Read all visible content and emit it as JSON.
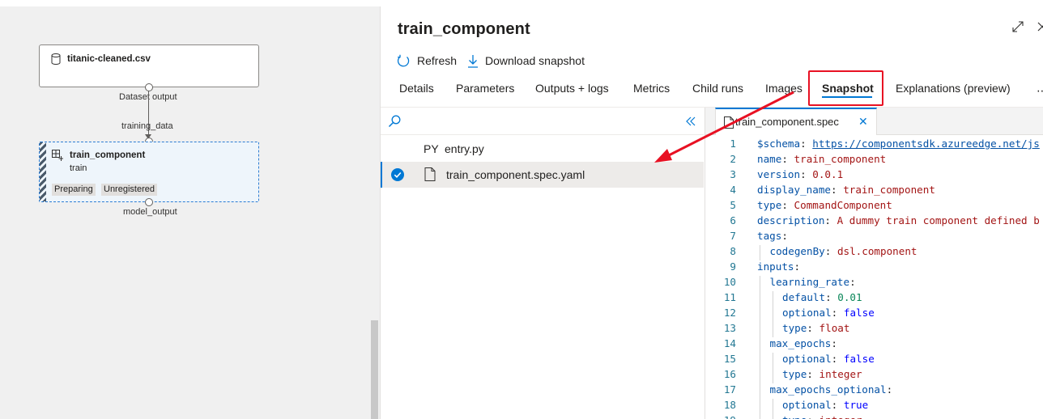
{
  "canvas": {
    "dataset_node": {
      "title": "titanic-cleaned.csv",
      "output_label": "Dataset output"
    },
    "edge_input_label": "training_data",
    "train_node": {
      "title": "train_component",
      "subtitle": "train",
      "badges": [
        "Preparing",
        "Unregistered"
      ],
      "output_label": "model_output"
    }
  },
  "panel": {
    "title": "train_component",
    "commands": {
      "refresh": "Refresh",
      "download": "Download snapshot"
    },
    "tabs": [
      "Details",
      "Parameters",
      "Outputs + logs",
      "Metrics",
      "Child runs",
      "Images",
      "Snapshot",
      "Explanations (preview)"
    ],
    "active_tab": "Snapshot",
    "files": [
      {
        "type": "PY",
        "name": "entry.py",
        "selected": false
      },
      {
        "type": "doc-icon",
        "name": "train_component.spec.yaml",
        "selected": true
      }
    ],
    "editor": {
      "tab_name": "train_component.spec.yaml",
      "lines": [
        {
          "no": "1",
          "indent": 0,
          "key": "$schema",
          "value": "https://componentsdk.azureedge.net/js",
          "vtype": "url"
        },
        {
          "no": "2",
          "indent": 0,
          "key": "name",
          "value": "train_component",
          "vtype": "str"
        },
        {
          "no": "3",
          "indent": 0,
          "key": "version",
          "value": "0.0.1",
          "vtype": "str"
        },
        {
          "no": "4",
          "indent": 0,
          "key": "display_name",
          "value": "train_component",
          "vtype": "str"
        },
        {
          "no": "5",
          "indent": 0,
          "key": "type",
          "value": "CommandComponent",
          "vtype": "str"
        },
        {
          "no": "6",
          "indent": 0,
          "key": "description",
          "value": "A dummy train component defined b",
          "vtype": "str"
        },
        {
          "no": "7",
          "indent": 0,
          "key": "tags",
          "value": "",
          "vtype": "none"
        },
        {
          "no": "8",
          "indent": 1,
          "key": "codegenBy",
          "value": "dsl.component",
          "vtype": "str"
        },
        {
          "no": "9",
          "indent": 0,
          "key": "inputs",
          "value": "",
          "vtype": "none"
        },
        {
          "no": "10",
          "indent": 1,
          "key": "learning_rate",
          "value": "",
          "vtype": "none"
        },
        {
          "no": "11",
          "indent": 2,
          "key": "default",
          "value": "0.01",
          "vtype": "num"
        },
        {
          "no": "12",
          "indent": 2,
          "key": "optional",
          "value": "false",
          "vtype": "kw"
        },
        {
          "no": "13",
          "indent": 2,
          "key": "type",
          "value": "float",
          "vtype": "str"
        },
        {
          "no": "14",
          "indent": 1,
          "key": "max_epochs",
          "value": "",
          "vtype": "none"
        },
        {
          "no": "15",
          "indent": 2,
          "key": "optional",
          "value": "false",
          "vtype": "kw"
        },
        {
          "no": "16",
          "indent": 2,
          "key": "type",
          "value": "integer",
          "vtype": "str"
        },
        {
          "no": "17",
          "indent": 1,
          "key": "max_epochs_optional",
          "value": "",
          "vtype": "none"
        },
        {
          "no": "18",
          "indent": 2,
          "key": "optional",
          "value": "true",
          "vtype": "kw"
        },
        {
          "no": "19",
          "indent": 2,
          "key": "type",
          "value": "integer",
          "vtype": "str"
        }
      ]
    }
  },
  "colors": {
    "accent": "#0078d4",
    "highlight": "#e81123",
    "canvas_bg": "#f0f0f0"
  }
}
